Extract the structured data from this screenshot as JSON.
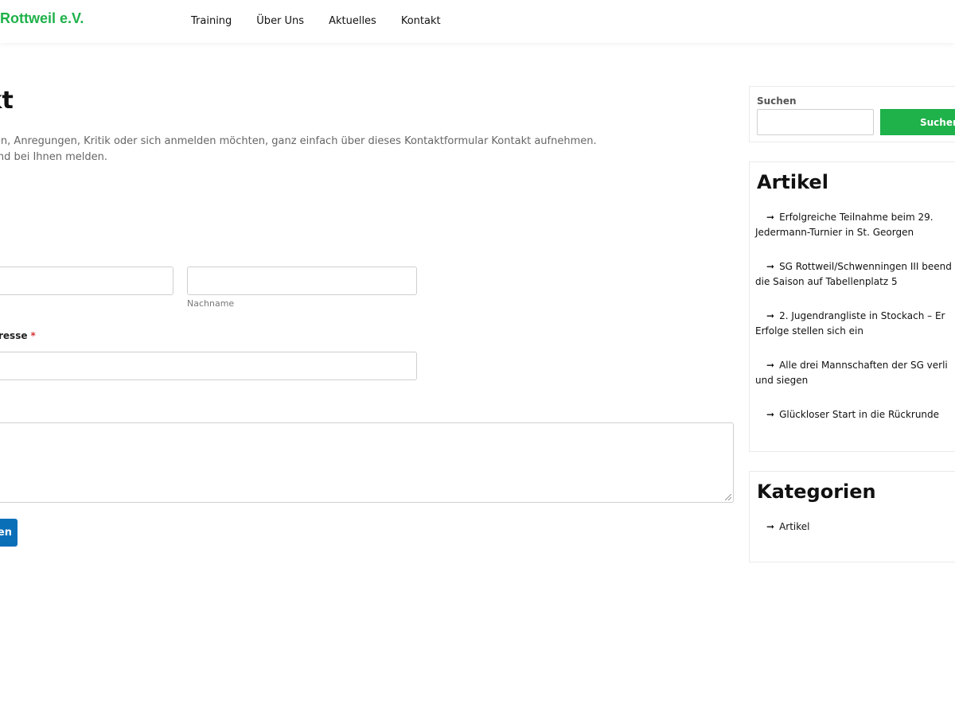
{
  "site": {
    "logo_text": "Rottweil e.V.",
    "brand_color": "#1fb14a"
  },
  "nav": {
    "items": [
      "Training",
      "Über Uns",
      "Aktuelles",
      "Kontakt"
    ]
  },
  "page": {
    "title": "takt",
    "intro_line1": "Fragen haben, Anregungen, Kritik oder sich anmelden möchten, ganz einfach über dieses Kontaktformular Kontakt aufnehmen.",
    "intro_line2": "h bald jemand bei Ihnen melden."
  },
  "form": {
    "lastname_sublabel": "Nachname",
    "email_label": "resse",
    "required_marker": "*",
    "submit_label": "en",
    "submit_color": "#0b6fb8"
  },
  "sidebar": {
    "search": {
      "label": "Suchen",
      "button_label": "Suchen"
    },
    "articles": {
      "title": "Artikel",
      "items": [
        {
          "line1": "Erfolgreiche Teilnahme beim 29.",
          "line2": "Jedermann-Turnier in St. Georgen"
        },
        {
          "line1": "SG Rottweil/Schwenningen III beend",
          "line2": "die Saison auf Tabellenplatz 5"
        },
        {
          "line1": "2. Jugendrangliste in Stockach – Er",
          "line2": "Erfolge stellen sich ein"
        },
        {
          "line1": "Alle drei Mannschaften der SG verli",
          "line2": "und siegen"
        },
        {
          "line1": "Glückloser Start in die Rückrunde",
          "line2": ""
        }
      ]
    },
    "categories": {
      "title": "Kategorien",
      "items": [
        "Artikel"
      ]
    },
    "arrow_glyph": "➞"
  }
}
